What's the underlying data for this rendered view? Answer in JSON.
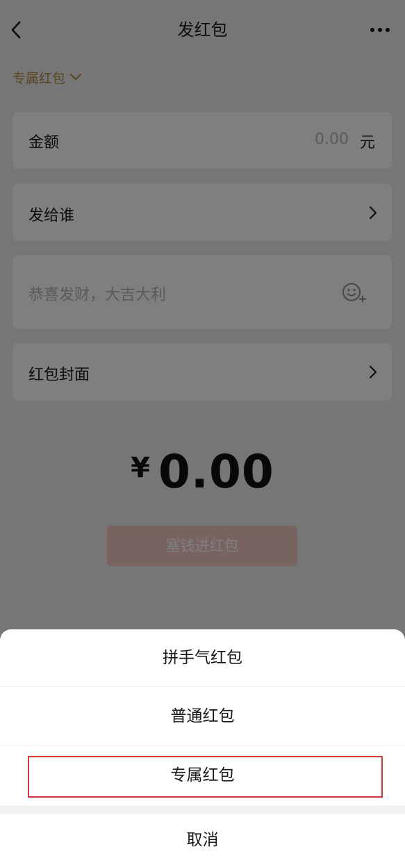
{
  "header": {
    "title": "发红包"
  },
  "type_selector": {
    "label": "专属红包"
  },
  "amount": {
    "label": "金额",
    "value": "0.00",
    "unit": "元"
  },
  "recipient": {
    "label": "发给谁"
  },
  "message": {
    "placeholder": "恭喜发财，大吉大利"
  },
  "cover": {
    "label": "红包封面"
  },
  "total": {
    "currency": "¥",
    "amount": "0.00"
  },
  "submit": {
    "label": "塞钱进红包"
  },
  "action_sheet": {
    "items": [
      {
        "label": "拼手气红包"
      },
      {
        "label": "普通红包"
      },
      {
        "label": "专属红包"
      }
    ],
    "cancel_label": "取消"
  },
  "colors": {
    "accent_gold": "#b08a3e",
    "highlight_border": "#d0383c",
    "overlay": "rgba(0,0,0,0.5)"
  },
  "icons": [
    "back-icon",
    "more-icon",
    "chevron-down-icon",
    "chevron-right-icon",
    "emoji-add-icon"
  ]
}
